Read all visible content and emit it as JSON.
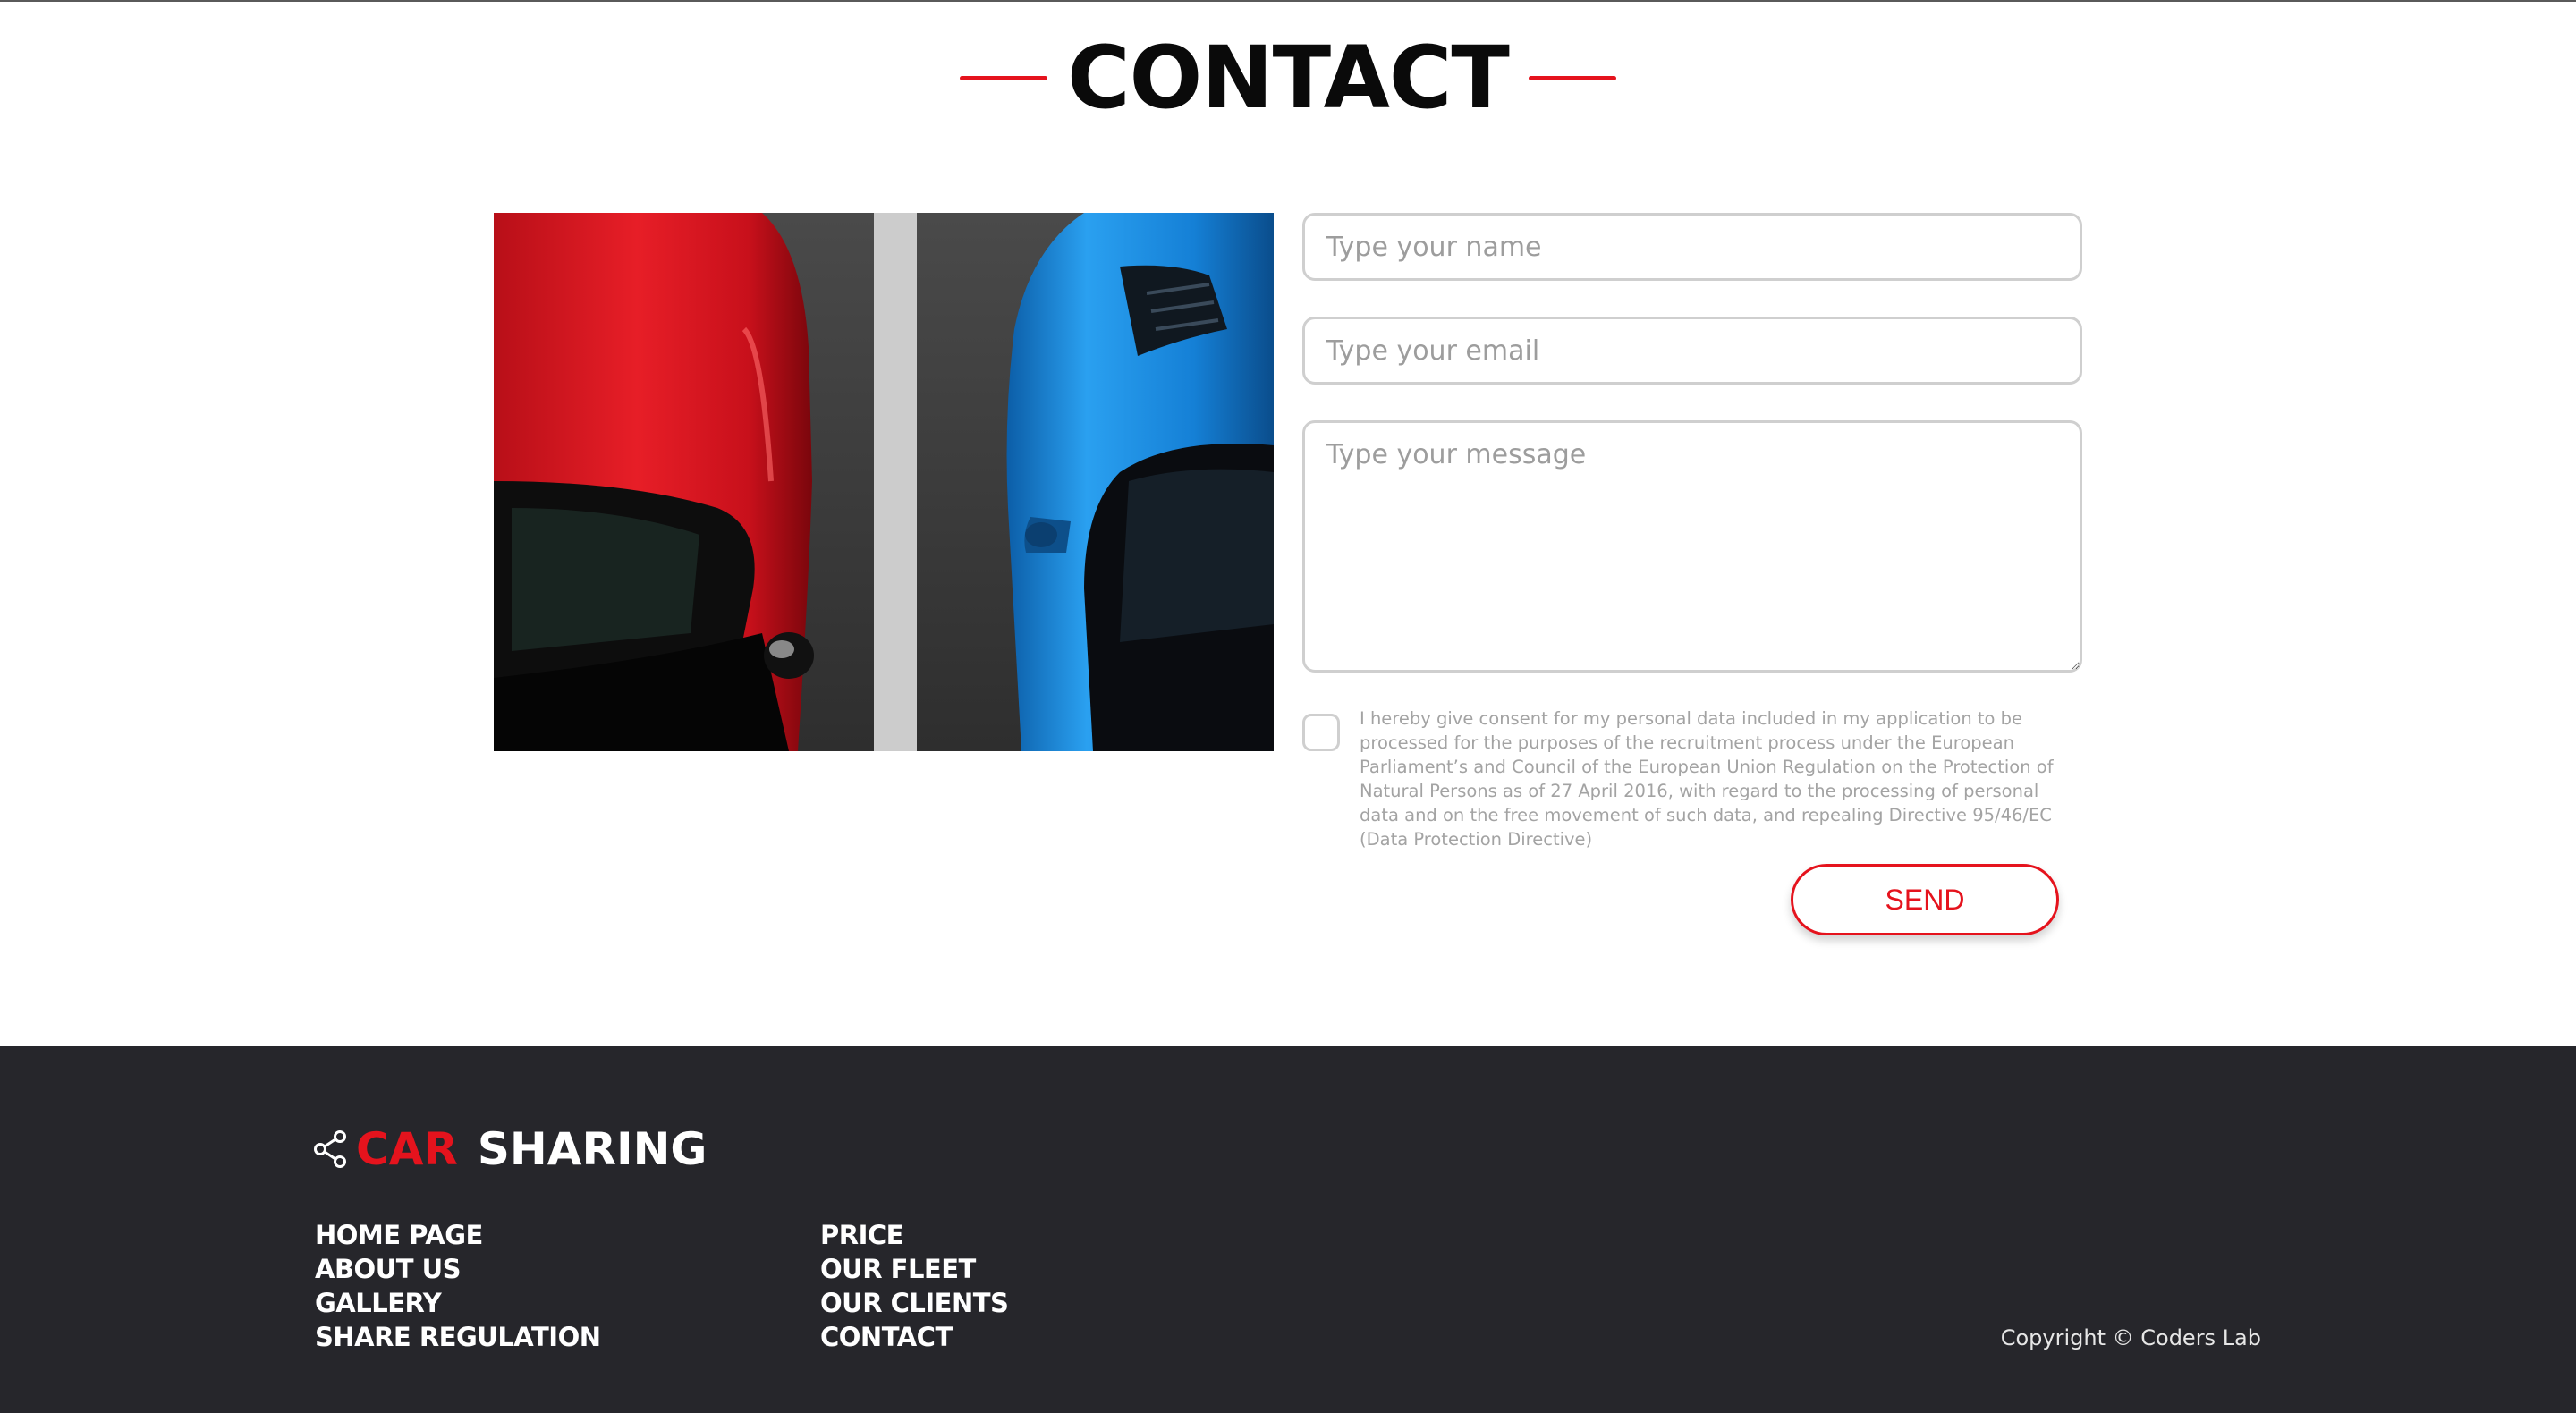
{
  "section": {
    "title": "CONTACT"
  },
  "photo": {
    "icon": "parked-cars-image",
    "colors": {
      "asphalt": "#414141",
      "red_car": "#e0141d",
      "blue_car": "#1a8de0",
      "line": "#d9d9d9"
    }
  },
  "form": {
    "name_placeholder": "Type your name",
    "email_placeholder": "Type your email",
    "message_placeholder": "Type your message",
    "consent_checked": false,
    "consent_text": "I hereby give consent for my personal data included in my application to be processed for the purposes of the recruitment process under the European Parliament’s and Council of the European Union Regulation on the Protection of Natural Persons as of 27 April 2016, with regard to the processing of personal data and on the free movement of such data, and repealing Directive 95/46/EC (Data Protection Directive)",
    "send_label": "SEND"
  },
  "footer": {
    "brand_icon": "share-icon",
    "brand_part1": "CAR",
    "brand_part2": "SHARING",
    "nav_col1": [
      "HOME PAGE",
      "ABOUT US",
      "GALLERY",
      "SHARE REGULATION"
    ],
    "nav_col2": [
      "PRICE",
      "OUR FLEET",
      "OUR CLIENTS",
      "CONTACT"
    ],
    "copyright": "Copyright © Coders Lab"
  },
  "colors": {
    "accent": "#e5131d",
    "footer_bg": "#26262b",
    "title": "#0a0a0a",
    "placeholder": "#9d9d9d"
  }
}
